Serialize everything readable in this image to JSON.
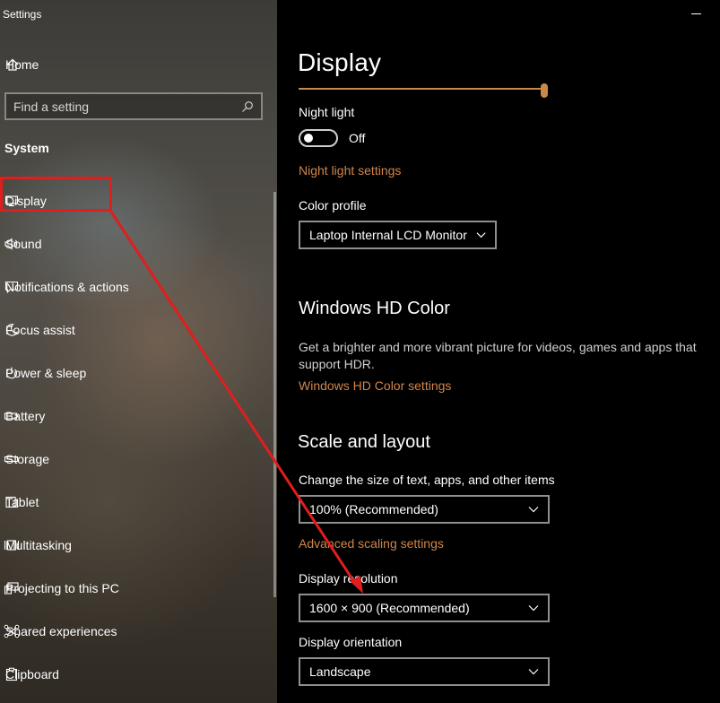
{
  "window": {
    "title": "Settings"
  },
  "sidebar": {
    "home_label": "Home",
    "search_placeholder": "Find a setting",
    "section_label": "System",
    "items": [
      {
        "label": "Display",
        "icon": "monitor-icon"
      },
      {
        "label": "Sound",
        "icon": "speaker-icon"
      },
      {
        "label": "Notifications & actions",
        "icon": "notification-icon"
      },
      {
        "label": "Focus assist",
        "icon": "moon-icon"
      },
      {
        "label": "Power & sleep",
        "icon": "power-icon"
      },
      {
        "label": "Battery",
        "icon": "battery-icon"
      },
      {
        "label": "Storage",
        "icon": "storage-icon"
      },
      {
        "label": "Tablet",
        "icon": "tablet-icon"
      },
      {
        "label": "Multitasking",
        "icon": "multitasking-icon"
      },
      {
        "label": "Projecting to this PC",
        "icon": "projecting-icon"
      },
      {
        "label": "Shared experiences",
        "icon": "shared-experiences-icon"
      },
      {
        "label": "Clipboard",
        "icon": "clipboard-icon"
      }
    ],
    "selected": "Display"
  },
  "main": {
    "title": "Display",
    "brightness": 1.0,
    "night_light": {
      "label": "Night light",
      "state": "Off",
      "settings_link": "Night light settings"
    },
    "color_profile": {
      "label": "Color profile",
      "value": "Laptop Internal LCD Monitor"
    },
    "hd_color": {
      "heading": "Windows HD Color",
      "description_line1": "Get a brighter and more vibrant picture for videos, games and apps that",
      "description_line2": "support HDR.",
      "link": "Windows HD Color settings"
    },
    "scale_layout": {
      "heading": "Scale and layout",
      "scale_label": "Change the size of text, apps, and other items",
      "scale_value": "100% (Recommended)",
      "advanced_link": "Advanced scaling settings",
      "resolution_label": "Display resolution",
      "resolution_value": "1600 × 900 (Recommended)",
      "orientation_label": "Display orientation",
      "orientation_value": "Landscape"
    }
  },
  "colors": {
    "accent": "#d2854a",
    "slider": "#c98a45",
    "annotation": "#e01e1e"
  }
}
